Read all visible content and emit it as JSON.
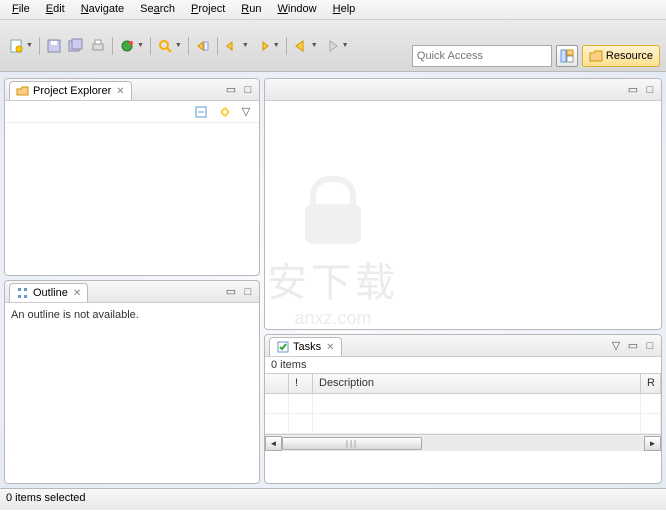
{
  "menu": {
    "file": "File",
    "edit": "Edit",
    "navigate": "Navigate",
    "search": "Search",
    "project": "Project",
    "run": "Run",
    "window": "Window",
    "help": "Help"
  },
  "quick_access": {
    "placeholder": "Quick Access"
  },
  "perspective": {
    "resource": "Resource"
  },
  "project_explorer": {
    "title": "Project Explorer"
  },
  "outline": {
    "title": "Outline",
    "message": "An outline is not available."
  },
  "tasks": {
    "title": "Tasks",
    "count": "0 items",
    "columns": {
      "c0": "",
      "c1": "!",
      "c2": "Description",
      "c3": "R"
    }
  },
  "status": {
    "text": "0 items selected"
  },
  "watermark": {
    "ch": "安下载",
    "en": "anxz.com"
  }
}
